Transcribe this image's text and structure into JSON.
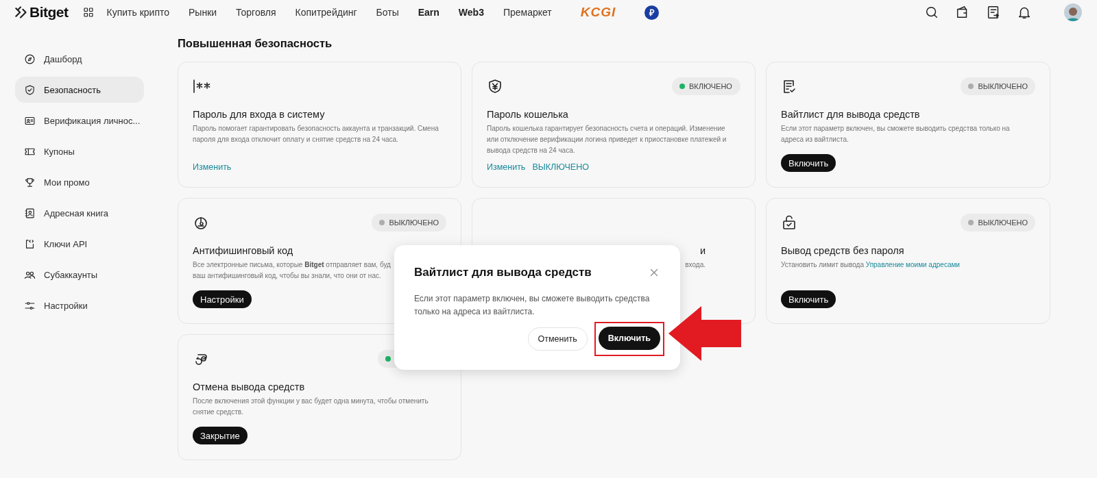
{
  "header": {
    "logo": "Bitget",
    "nav": [
      {
        "label": "Купить крипто",
        "emphasized": false
      },
      {
        "label": "Рынки",
        "emphasized": false
      },
      {
        "label": "Торговля",
        "emphasized": false
      },
      {
        "label": "Копитрейдинг",
        "emphasized": false
      },
      {
        "label": "Боты",
        "emphasized": false
      },
      {
        "label": "Earn",
        "emphasized": true
      },
      {
        "label": "Web3",
        "emphasized": true
      },
      {
        "label": "Премаркет",
        "emphasized": false
      }
    ],
    "promo": "KCGI",
    "currency_badge": "₽"
  },
  "sidebar": {
    "items": [
      {
        "label": "Дашборд",
        "selected": false
      },
      {
        "label": "Безопасность",
        "selected": true
      },
      {
        "label": "Верификация личнос...",
        "selected": false
      },
      {
        "label": "Купоны",
        "selected": false
      },
      {
        "label": "Мои промо",
        "selected": false
      },
      {
        "label": "Адресная книга",
        "selected": false
      },
      {
        "label": "Ключи API",
        "selected": false
      },
      {
        "label": "Субаккаунты",
        "selected": false
      },
      {
        "label": "Настройки",
        "selected": false
      }
    ]
  },
  "section_title": "Повышенная безопасность",
  "cards": [
    {
      "kind": "full",
      "title": "Пароль для входа в систему",
      "lines": [
        "Пароль помогает гарантировать безопасность аккаунта и транзакций. Смена",
        "пароля для входа отключит оплату и снятие средств на 24 часа."
      ],
      "actions": [
        {
          "kind": "link",
          "label": "Изменить"
        }
      ]
    },
    {
      "kind": "full",
      "status": {
        "on": true,
        "label": "ВКЛЮЧЕНО"
      },
      "title": "Пароль кошелька",
      "lines": [
        "Пароль кошелька гарантирует безопасность счета и операций. Изменение",
        "или отключение верификации логина приведет к приостановке платежей и",
        "вывода средств на 24 часа."
      ],
      "actions": [
        {
          "kind": "link",
          "label": "Изменить"
        },
        {
          "kind": "link",
          "label": "ВЫКЛЮЧЕНО"
        }
      ]
    },
    {
      "kind": "full",
      "status": {
        "on": false,
        "label": "ВЫКЛЮЧЕНО"
      },
      "title": "Вайтлист для вывода средств",
      "lines": [
        "Если этот параметр включен, вы сможете выводить средства только на",
        "адреса из вайтлиста."
      ],
      "actions": [
        {
          "kind": "button",
          "label": "Включить"
        }
      ]
    },
    {
      "kind": "full",
      "status": {
        "on": false,
        "label": "ВЫКЛЮЧЕНО"
      },
      "title": "Антифишинговый код",
      "lines": [
        "Все электронные письма, которые **Bitget** отправляет вам, буд",
        "ваш антифишинговый код, чтобы вы знали, что они от нас."
      ],
      "actions": [
        {
          "kind": "button",
          "label": "Настройки"
        }
      ]
    },
    {
      "kind": "covered",
      "title": "и",
      "lines": [
        "входа."
      ]
    },
    {
      "kind": "full",
      "status": {
        "on": false,
        "label": "ВЫКЛЮЧЕНО"
      },
      "title": "Вывод средств без пароля",
      "lines": [
        "Установить лимит вывода"
      ],
      "link": "Управление моими адресами",
      "actions": [
        {
          "kind": "button",
          "label": "Включить"
        }
      ]
    },
    {
      "kind": "full",
      "status": {
        "on": true
      },
      "title": "Отмена вывода средств",
      "lines": [
        "После включения этой функции у вас будет одна минута, чтобы отменить",
        "снятие средств."
      ],
      "actions": [
        {
          "kind": "button",
          "label": "Закрытие"
        }
      ]
    }
  ],
  "modal": {
    "title": "Вайтлист для вывода средств",
    "lines": [
      "Если этот параметр включен, вы сможете выводить средства",
      "только на адреса из вайтлиста."
    ],
    "buttons": [
      {
        "kind": "secondary",
        "label": "Отменить",
        "highlighted": false
      },
      {
        "kind": "primary",
        "label": "Включить",
        "highlighted": true
      }
    ]
  }
}
